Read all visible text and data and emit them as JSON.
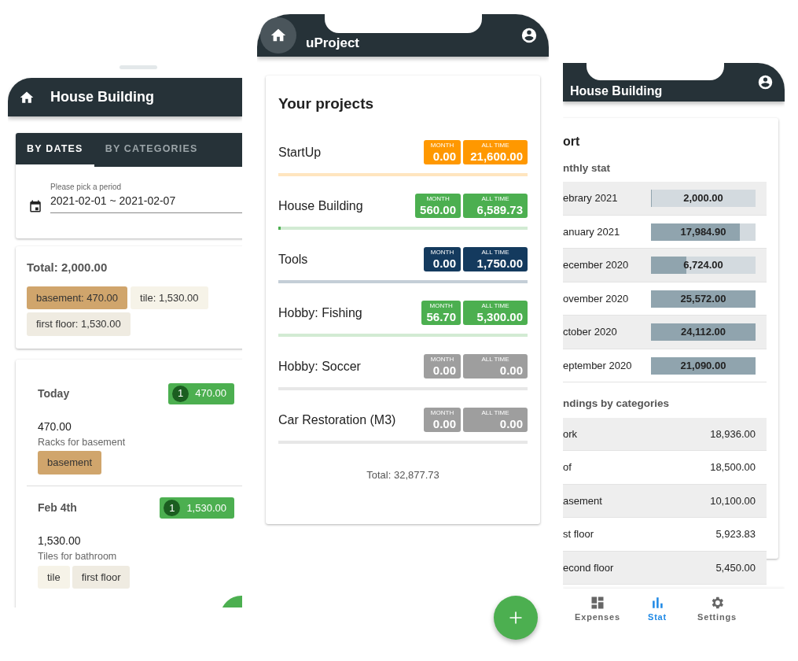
{
  "left_screen": {
    "header": {
      "title": "House Building"
    },
    "tabs": [
      {
        "label": "BY DATES",
        "selected": true
      },
      {
        "label": "BY CATEGORIES",
        "selected": false
      }
    ],
    "period": {
      "label": "Please pick a period",
      "value": "2021-02-01 ~ 2021-02-07"
    },
    "total": "Total: 2,000.00",
    "category_chips": [
      {
        "label": "basement: 470.00",
        "color": "#d0a56c"
      },
      {
        "label": "tile: 1,530.00",
        "color": "#f6f3e8"
      },
      {
        "label": "first floor: 1,530.00",
        "color": "#efebe1"
      }
    ],
    "days": [
      {
        "date": "Today",
        "count": "1",
        "sum": "470.00",
        "amount": "470.00",
        "description": "Racks for basement",
        "tags": [
          {
            "label": "basement",
            "color": "#d0a56c"
          }
        ]
      },
      {
        "date": "Feb 4th",
        "count": "1",
        "sum": "1,530.00",
        "amount": "1,530.00",
        "description": "Tiles for bathroom",
        "tags": [
          {
            "label": "tile",
            "color": "#f6f3e8"
          },
          {
            "label": "first floor",
            "color": "#efebe1"
          }
        ]
      }
    ]
  },
  "middle_screen": {
    "header": {
      "title": "uProject"
    },
    "card_title": "Your projects",
    "projects": [
      {
        "name": "StartUp",
        "color": "#ff9800",
        "month_label": "MONTH",
        "month": "0.00",
        "all_time_label": "ALL TIME",
        "all_time": "21,600.00",
        "level": 0
      },
      {
        "name": "House Building",
        "color": "#4caf50",
        "month_label": "MONTH",
        "month": "560.00",
        "all_time_label": "ALL TIME",
        "all_time": "6,589.73",
        "level": 0.01
      },
      {
        "name": "Tools",
        "color": "#143a5e",
        "month_label": "MONTH",
        "month": "0.00",
        "all_time_label": "ALL TIME",
        "all_time": "1,750.00",
        "level": 0
      },
      {
        "name": "Hobby: Fishing",
        "color": "#4caf50",
        "month_label": "MONTH",
        "month": "56.70",
        "all_time_label": "ALL TIME",
        "all_time": "5,300.00",
        "level": 0
      },
      {
        "name": "Hobby: Soccer",
        "color": "#9e9e9e",
        "month_label": "MONTH",
        "month": "0.00",
        "all_time_label": "ALL TIME",
        "all_time": "0.00",
        "level": 0
      },
      {
        "name": "Car Restoration (M3)",
        "color": "#9e9e9e",
        "month_label": "MONTH",
        "month": "0.00",
        "all_time_label": "ALL TIME",
        "all_time": "0.00",
        "level": 0
      }
    ],
    "total": "Total: 32,877.73"
  },
  "right_screen": {
    "header": {
      "title": "House Building"
    },
    "report_title": "ort",
    "monthly_title": "nthly stat",
    "months": [
      {
        "label": "ebrary 2021",
        "value": "2,000.00",
        "level": 0.01
      },
      {
        "label": "anuary 2021",
        "value": "17,984.90",
        "level": 0.85
      },
      {
        "label": "ecember 2020",
        "value": "6,724.00",
        "level": 0.34
      },
      {
        "label": "ovember 2020",
        "value": "25,572.00",
        "level": 1
      },
      {
        "label": "ctober 2020",
        "value": "24,112.00",
        "level": 1
      },
      {
        "label": "eptember 2020",
        "value": "21,090.00",
        "level": 1
      }
    ],
    "categories_title": "ndings by categories",
    "categories": [
      {
        "name": "ork",
        "value": "18,936.00"
      },
      {
        "name": "of",
        "value": "18,500.00"
      },
      {
        "name": "asement",
        "value": "10,100.00"
      },
      {
        "name": "st floor",
        "value": "5,923.83"
      },
      {
        "name": "econd floor",
        "value": "5,450.00"
      }
    ],
    "nav": [
      {
        "label": "Expenses",
        "kind": "dashboard",
        "selected": false
      },
      {
        "label": "Stat",
        "kind": "chart",
        "selected": true
      },
      {
        "label": "Settings",
        "kind": "gear",
        "selected": false
      }
    ]
  }
}
